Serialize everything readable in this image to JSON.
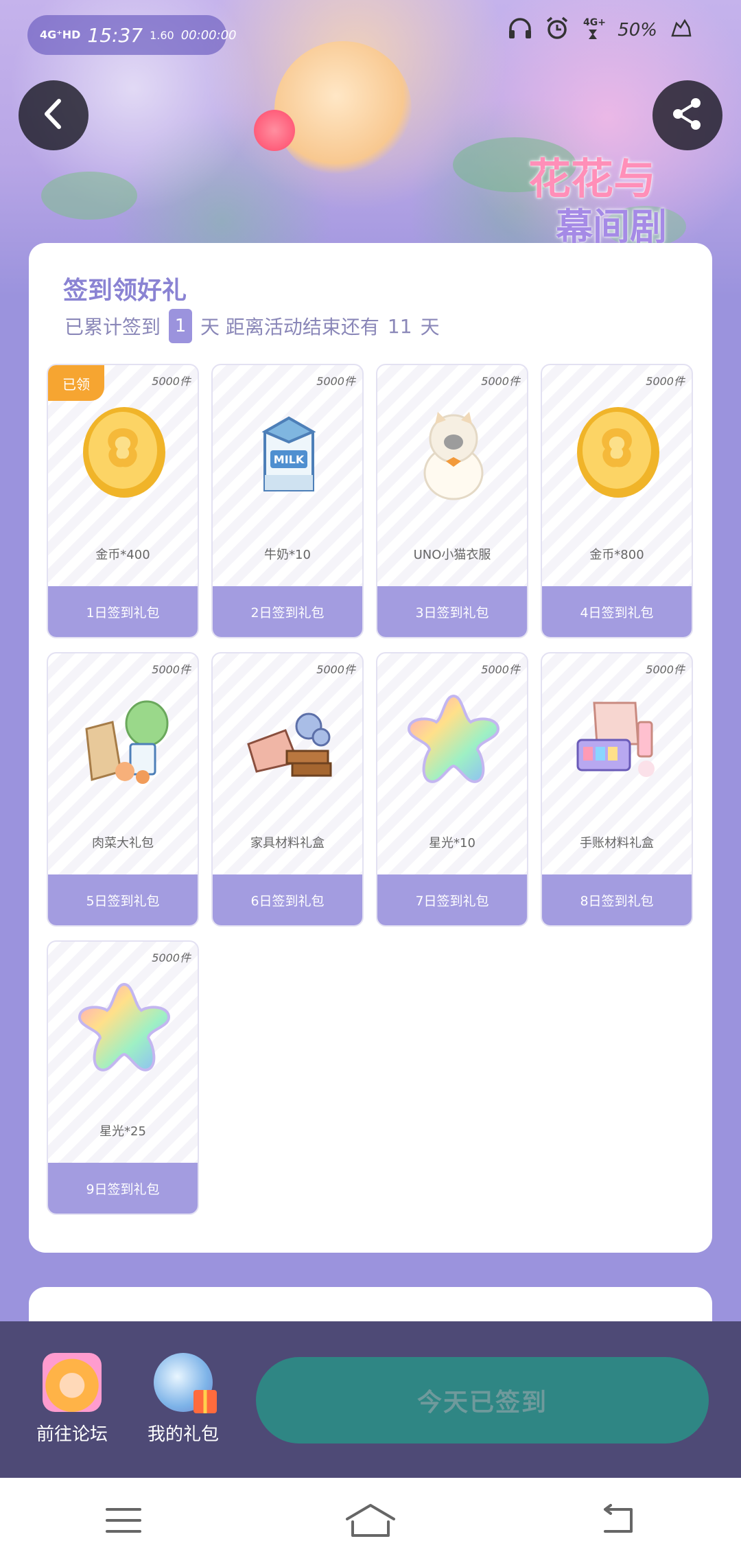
{
  "status_bar": {
    "network": "4G⁺HD",
    "time": "15:37",
    "speed": "1.60",
    "timer": "00:00:00",
    "battery": "50%"
  },
  "header": {
    "logo_line1": "花花与",
    "logo_line2": "幕间剧"
  },
  "signin": {
    "title": "签到领好礼",
    "sub_prefix": "已累计签到",
    "days_signed": "1",
    "sub_mid": "天  距离活动结束还有",
    "days_left": "11",
    "sub_suffix": "天"
  },
  "gifts": [
    {
      "stock": "5000件",
      "name": "金币*400",
      "day": "1日签到礼包",
      "claimed": "已领",
      "icon": "gold-coin-icon"
    },
    {
      "stock": "5000件",
      "name": "牛奶*10",
      "day": "2日签到礼包",
      "icon": "milk-carton-icon"
    },
    {
      "stock": "5000件",
      "name": "UNO小猫衣服",
      "day": "3日签到礼包",
      "icon": "cat-costume-icon"
    },
    {
      "stock": "5000件",
      "name": "金币*800",
      "day": "4日签到礼包",
      "icon": "gold-coin-icon"
    },
    {
      "stock": "5000件",
      "name": "肉菜大礼包",
      "day": "5日签到礼包",
      "icon": "grocery-bag-icon"
    },
    {
      "stock": "5000件",
      "name": "家具材料礼盒",
      "day": "6日签到礼包",
      "icon": "wood-materials-icon"
    },
    {
      "stock": "5000件",
      "name": "星光*10",
      "day": "7日签到礼包",
      "icon": "rainbow-star-icon"
    },
    {
      "stock": "5000件",
      "name": "手账材料礼盒",
      "day": "8日签到礼包",
      "icon": "stationery-box-icon"
    },
    {
      "stock": "5000件",
      "name": "星光*25",
      "day": "9日签到礼包",
      "icon": "rainbow-star-icon"
    }
  ],
  "actions": {
    "forum": "前往论坛",
    "bag": "我的礼包",
    "signed": "今天已签到"
  },
  "colors": {
    "accent": "#9b93dd",
    "claimed_badge": "#f6a531",
    "signed_button": "#2f8684",
    "action_bar": "#4e4a76"
  }
}
